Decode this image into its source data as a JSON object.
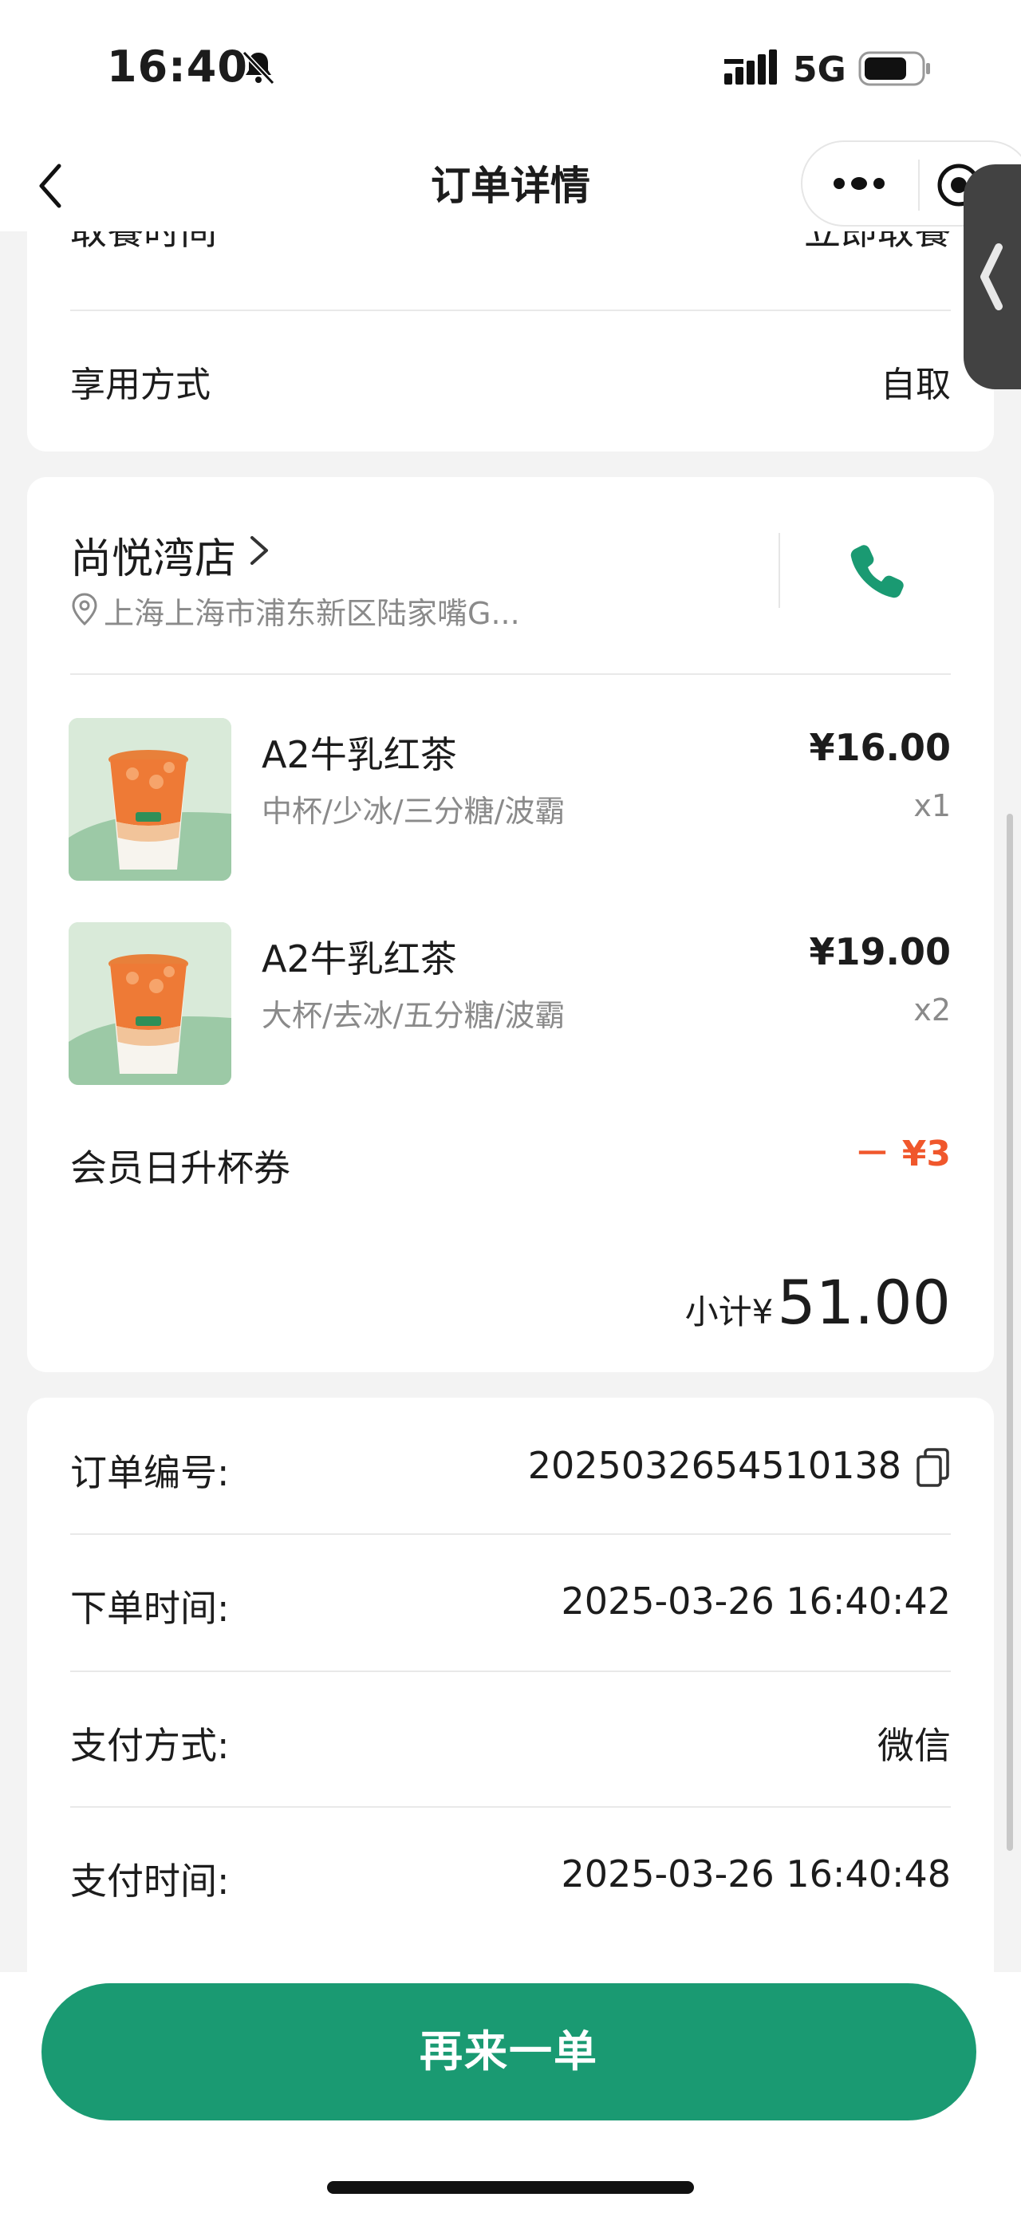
{
  "status_bar": {
    "time": "16:40",
    "network": "5G"
  },
  "nav": {
    "title": "订单详情"
  },
  "pickup": {
    "time_label": "取餐时间",
    "time_value": "立即取餐",
    "method_label": "享用方式",
    "method_value": "自取"
  },
  "store": {
    "name": "尚悦湾店",
    "address": "上海上海市浦东新区陆家嘴G..."
  },
  "items": [
    {
      "name": "A2牛乳红茶",
      "spec": "中杯/少冰/三分糖/波霸",
      "price": "¥16.00",
      "qty": "x1"
    },
    {
      "name": "A2牛乳红茶",
      "spec": "大杯/去冰/五分糖/波霸",
      "price": "¥19.00",
      "qty": "x2"
    }
  ],
  "coupon": {
    "label": "会员日升杯券",
    "value": "－ ¥3"
  },
  "subtotal": {
    "label": "小计¥",
    "value": "51.00"
  },
  "order_info": [
    {
      "label": "订单编号:",
      "value": "2025032654510138"
    },
    {
      "label": "下单时间:",
      "value": "2025-03-26 16:40:42"
    },
    {
      "label": "支付方式:",
      "value": "微信"
    },
    {
      "label": "支付时间:",
      "value": "2025-03-26 16:40:48"
    }
  ],
  "actions": {
    "reorder": "再来一单"
  },
  "colors": {
    "brand": "#1a9a72",
    "discount": "#f0572c"
  },
  "icons": [
    "bell-slash-icon",
    "signal-icon",
    "battery-icon",
    "back-icon",
    "more-icon",
    "target-icon",
    "chevron-right-icon",
    "location-pin-icon",
    "phone-icon",
    "copy-icon"
  ]
}
